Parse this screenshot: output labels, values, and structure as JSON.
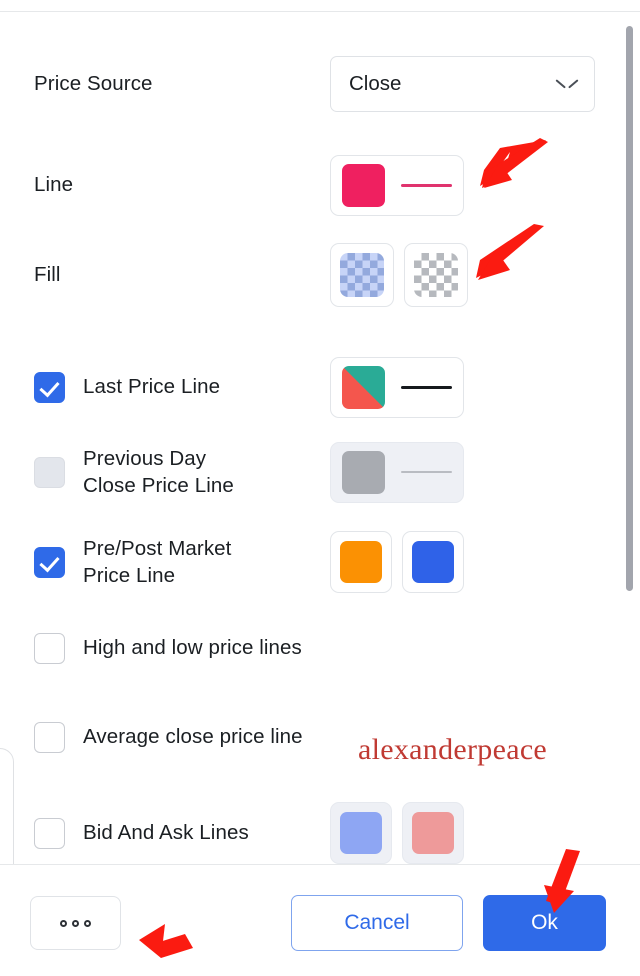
{
  "dialog": {
    "rows": [
      {
        "id": "price-source",
        "label": "Price Source",
        "control": "select",
        "value": "Close",
        "chevron_icon": "chevron-down-icon"
      },
      {
        "id": "line",
        "label": "Line",
        "control": "color-line",
        "color": "#ef2060",
        "line_color": "#e0336e"
      },
      {
        "id": "fill",
        "label": "Fill",
        "control": "two-checker-swatches",
        "swatch_1": "checker-blue",
        "swatch_2": "checker-gray"
      },
      {
        "id": "last-price-line",
        "label": "Last Price Line",
        "control": "diag-color-line",
        "checked": true,
        "color_up": "#2aab96",
        "color_down": "#f4564d",
        "line_color": "#16191d"
      },
      {
        "id": "previous-day-close-price-line",
        "label_line_1": "Previous Day",
        "label_line_2": "Close Price Line",
        "control": "color-line",
        "checked": false,
        "disabled": true,
        "color": "#a8abb1",
        "line_color": "#b9bcc2"
      },
      {
        "id": "pre-post-market-price-line",
        "label_line_1": "Pre/Post Market",
        "label_line_2": "Price Line",
        "control": "two-color-swatches",
        "checked": true,
        "color_1": "#fb9103",
        "color_2": "#2f62e8"
      },
      {
        "id": "high-and-low-price-lines",
        "label": "High and low price lines",
        "control": "none",
        "checked": false
      },
      {
        "id": "average-close-price-line",
        "label": "Average close price line",
        "control": "none",
        "checked": false
      },
      {
        "id": "bid-and-ask-lines",
        "label": "Bid And Ask Lines",
        "control": "two-color-swatches",
        "checked": false,
        "disabled": true,
        "color_1": "#8ea6f3",
        "color_2": "#ee9a9a"
      }
    ]
  },
  "footer": {
    "more_options_label": "",
    "more_options_icon": "three-dots-icon",
    "cancel_label": "Cancel",
    "ok_label": "Ok"
  },
  "annotations": {
    "watermark": "alexanderpeace",
    "arrow_color": "#fb1b11",
    "arrows": [
      {
        "name": "arrow-pointing-to-line-swatch"
      },
      {
        "name": "arrow-pointing-to-fill-swatch"
      },
      {
        "name": "arrow-pointing-to-ok-button"
      },
      {
        "name": "arrow-pointing-to-more-options-button"
      }
    ]
  },
  "colors": {
    "accent_blue": "#2f6ae8",
    "line_pink": "#ef2060",
    "up_green": "#2aab96",
    "down_red": "#f4564d",
    "orange": "#fb9103",
    "watermark_red": "#c03a33"
  },
  "scrollbar": {
    "name": "vertical-scrollbar"
  }
}
